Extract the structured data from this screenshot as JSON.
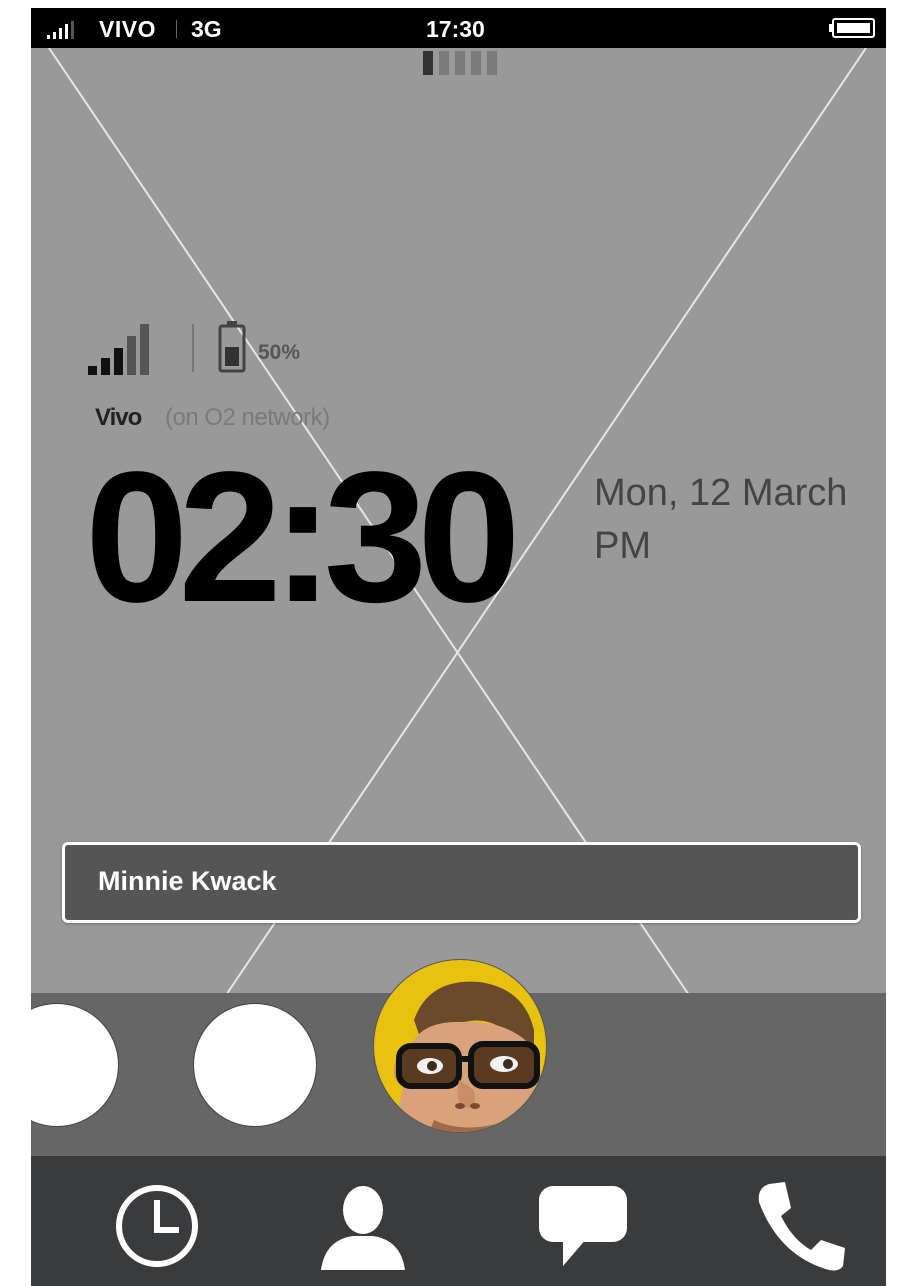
{
  "status_bar": {
    "carrier": "VIVO",
    "network": "3G",
    "time": "17:30",
    "signal_icon": "signal-bars-icon",
    "battery_icon": "battery-icon"
  },
  "lock_screen": {
    "battery_percent": "50%",
    "carrier_name": "Vivo",
    "carrier_network": "(on O2 network)",
    "clock": "02:30",
    "date": "Mon, 12 March",
    "ampm": "PM",
    "page_indicator_icon": "page-indicator-icon"
  },
  "notification": {
    "name": "Minnie Kwack"
  },
  "contacts": {
    "items": [
      {
        "icon": "contact-placeholder-icon"
      },
      {
        "icon": "contact-placeholder-icon"
      },
      {
        "icon": "contact-avatar"
      }
    ]
  },
  "dock": {
    "items": [
      {
        "icon": "clock-icon"
      },
      {
        "icon": "person-icon"
      },
      {
        "icon": "chat-bubble-icon"
      },
      {
        "icon": "phone-icon"
      }
    ]
  },
  "colors": {
    "screen_background": "#999999",
    "status_bar": "#000000",
    "notification": "#555555",
    "contact_strip": "#666666",
    "dock": "#3a3b3d",
    "avatar_background": "#e8c20e"
  }
}
